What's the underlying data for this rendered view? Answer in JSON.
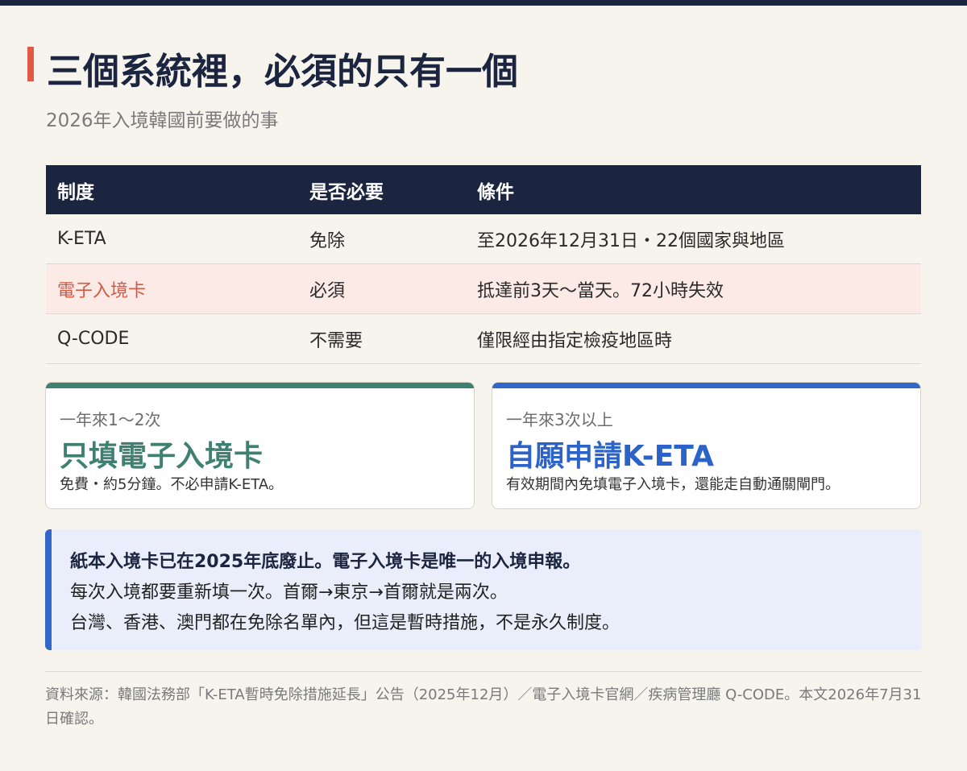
{
  "header": {
    "title": "三個系統裡，必須的只有一個",
    "subtitle": "2026年入境韓國前要做的事"
  },
  "table": {
    "columns": [
      "制度",
      "是否必要",
      "條件"
    ],
    "rows": [
      [
        "K-ETA",
        "免除",
        "至2026年12月31日・22個國家與地區"
      ],
      [
        "電子入境卡",
        "必須",
        "抵達前3天～當天。72小時失效"
      ],
      [
        "Q-CODE",
        "不需要",
        "僅限經由指定檢疫地區時"
      ]
    ]
  },
  "cards": [
    {
      "kicker": "一年來1～2次",
      "headline": "只填電子入境卡",
      "desc": "免費・約5分鐘。不必申請K-ETA。"
    },
    {
      "kicker": "一年來3次以上",
      "headline": "自願申請K-ETA",
      "desc": "有效期間內免填電子入境卡，還能走自動通關閘門。"
    }
  ],
  "note": {
    "lines": [
      "紙本入境卡已在2025年底廢止。電子入境卡是唯一的入境申報。",
      "每次入境都要重新填一次。首爾→東京→首爾就是兩次。",
      "台灣、香港、澳門都在免除名單內，但這是暫時措施，不是永久制度。"
    ]
  },
  "source": "資料來源：韓國法務部「K-ETA暫時免除措施延長」公告（2025年12月）／電子入境卡官網／疾病管理廳 Q-CODE。本文2026年7月31日確認。",
  "colors": {
    "navy": "#1b2540",
    "accent_red": "#e05a47",
    "green": "#3f8070",
    "blue": "#3266c8",
    "highlight_row": "#fbeae6",
    "note_bg": "#e9eefa"
  }
}
